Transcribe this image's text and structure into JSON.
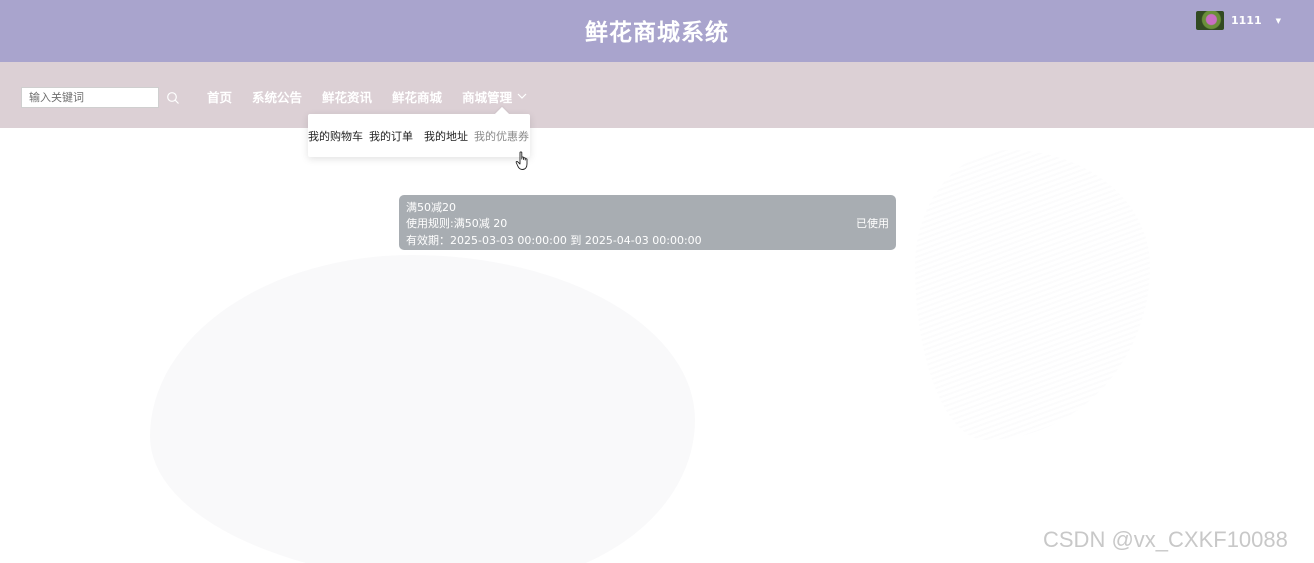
{
  "header": {
    "title": "鲜花商城系统",
    "username": "1111"
  },
  "search": {
    "placeholder": "输入关键词"
  },
  "nav": {
    "items": [
      "首页",
      "系统公告",
      "鲜花资讯",
      "鲜花商城",
      "商城管理"
    ]
  },
  "dropdown": {
    "items": [
      "我的购物车",
      "我的订单",
      "我的地址",
      "我的优惠券"
    ],
    "active": "我的优惠券"
  },
  "coupon": {
    "name": "满50减20",
    "rule": "使用规则:满50减 20",
    "validity": "有效期：2025-03-03 00:00:00 到 2025-04-03 00:00:00",
    "status": "已使用"
  },
  "watermark": "CSDN @vx_CXKF10088",
  "colors": {
    "header_bg": "#a9a4cd",
    "navbar_bg": "#dcd0d5",
    "coupon_bg": "#a8adb2"
  },
  "icons": [
    "search-icon",
    "chevron-down-icon",
    "caret-down-icon",
    "pointer-cursor-icon"
  ]
}
